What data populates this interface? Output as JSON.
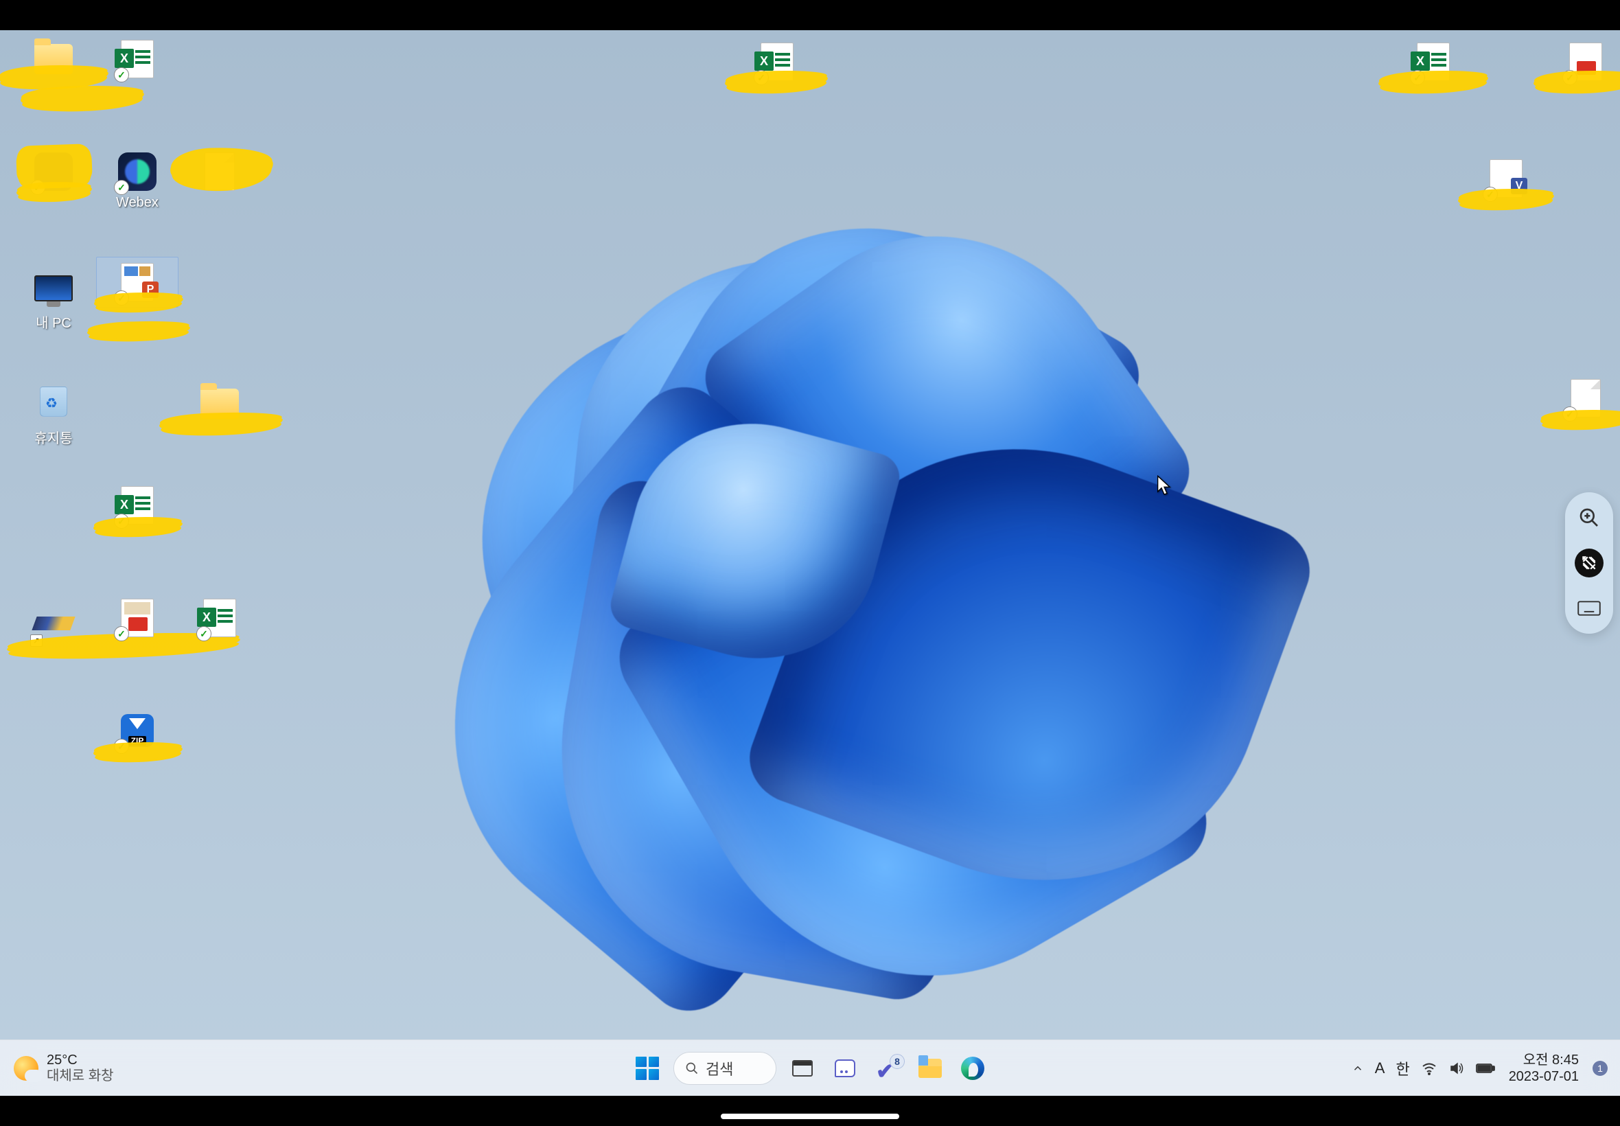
{
  "weather": {
    "temp": "25°C",
    "condition": "대체로 화창"
  },
  "search": {
    "placeholder": "검색"
  },
  "todo_badge": "8",
  "ime": {
    "mode": "A",
    "lang": "한"
  },
  "clock": {
    "time": "오전 8:45",
    "date": "2023-07-01"
  },
  "notification_count": "1",
  "zip_label": "ZIP",
  "desktop": {
    "webex_label": "Webex",
    "this_pc_label": "내 PC",
    "recycle_bin_label": "휴지통"
  }
}
